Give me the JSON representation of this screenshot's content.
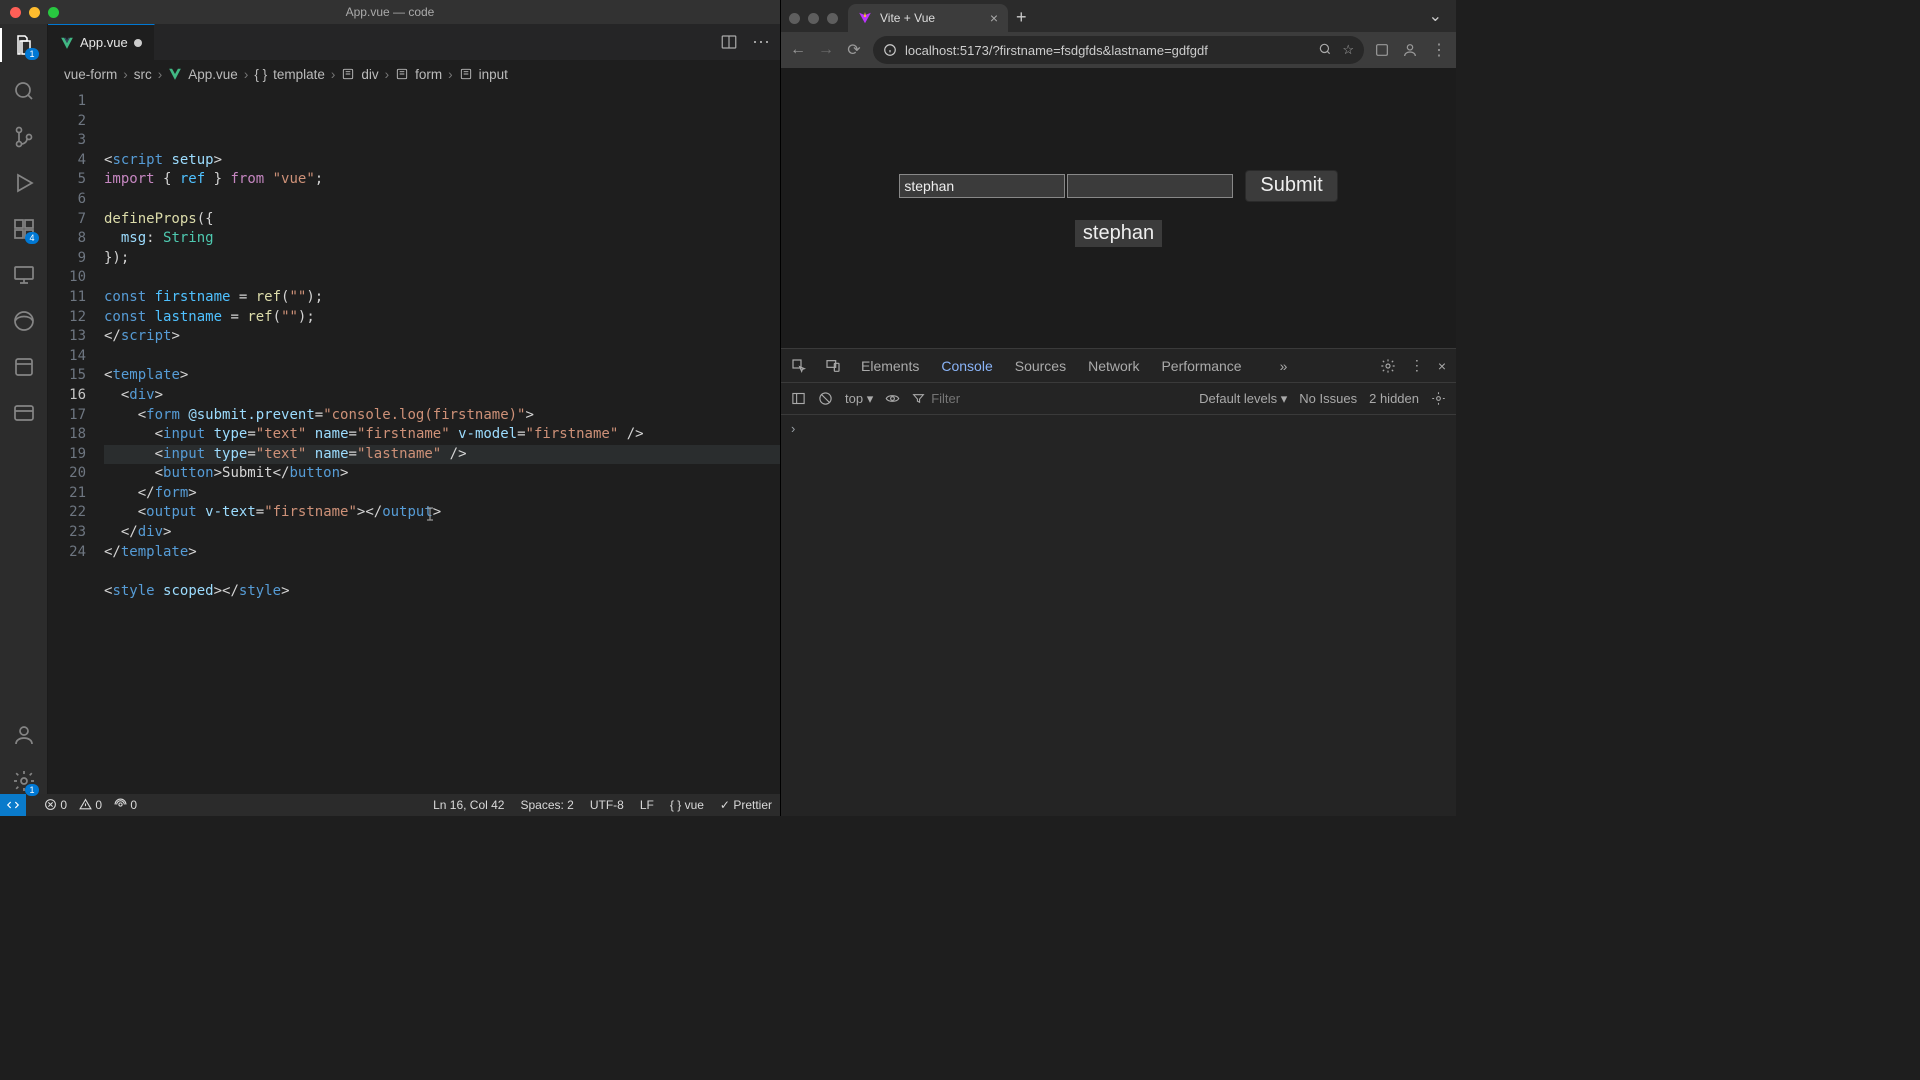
{
  "vscode": {
    "window_title": "App.vue — code",
    "tab": {
      "label": "App.vue"
    },
    "tab_actions": {
      "split": "▢",
      "more": "⋯"
    },
    "breadcrumbs": [
      "vue-form",
      "src",
      "App.vue",
      "template",
      "div",
      "form",
      "input"
    ],
    "gutter_highlight": 16,
    "code_lines": [
      {
        "n": 1,
        "html": "&lt;<span class='t-tag'>script</span> <span class='t-attr'>setup</span>&gt;"
      },
      {
        "n": 2,
        "html": "<span class='t-key'>import</span> { <span class='t-const'>ref</span> } <span class='t-key'>from</span> <span class='t-str'>\"vue\"</span>;"
      },
      {
        "n": 3,
        "html": ""
      },
      {
        "n": 4,
        "html": "<span class='t-fn'>defineProps</span>({"
      },
      {
        "n": 5,
        "html": "  <span class='t-attr'>msg</span>: <span class='t-type'>String</span>"
      },
      {
        "n": 6,
        "html": "});"
      },
      {
        "n": 7,
        "html": ""
      },
      {
        "n": 8,
        "html": "<span class='t-tag'>const</span> <span class='t-const'>firstname</span> = <span class='t-fn'>ref</span>(<span class='t-str'>\"\"</span>);"
      },
      {
        "n": 9,
        "html": "<span class='t-tag'>const</span> <span class='t-const'>lastname</span> = <span class='t-fn'>ref</span>(<span class='t-str'>\"\"</span>);"
      },
      {
        "n": 10,
        "html": "&lt;/<span class='t-tag'>script</span>&gt;"
      },
      {
        "n": 11,
        "html": ""
      },
      {
        "n": 12,
        "html": "&lt;<span class='t-tag'>template</span>&gt;"
      },
      {
        "n": 13,
        "html": "  &lt;<span class='t-tag'>div</span>&gt;"
      },
      {
        "n": 14,
        "html": "    &lt;<span class='t-tag'>form</span> <span class='t-attr'>@submit.prevent</span>=<span class='t-str'>\"console.log(firstname)\"</span>&gt;"
      },
      {
        "n": 15,
        "html": "      &lt;<span class='t-tag'>input</span> <span class='t-attr'>type</span>=<span class='t-str'>\"text\"</span> <span class='t-attr'>name</span>=<span class='t-str'>\"firstname\"</span> <span class='t-attr'>v-model</span>=<span class='t-str'>\"firstname\"</span> /&gt;"
      },
      {
        "n": 16,
        "html": "      &lt;<span class='t-tag'>input</span> <span class='t-attr'>type</span>=<span class='t-str'>\"text\"</span> <span class='t-attr'>name</span>=<span class='t-str'>\"lastname\"</span> /&gt;",
        "hl": true
      },
      {
        "n": 17,
        "html": "      &lt;<span class='t-tag'>button</span>&gt;Submit&lt;/<span class='t-tag'>button</span>&gt;"
      },
      {
        "n": 18,
        "html": "    &lt;/<span class='t-tag'>form</span>&gt;"
      },
      {
        "n": 19,
        "html": "    &lt;<span class='t-tag'>output</span> <span class='t-attr'>v-text</span>=<span class='t-str'>\"firstname\"</span>&gt;&lt;/<span class='t-tag'>output</span>&gt;"
      },
      {
        "n": 20,
        "html": "  &lt;/<span class='t-tag'>div</span>&gt;"
      },
      {
        "n": 21,
        "html": "&lt;/<span class='t-tag'>template</span>&gt;"
      },
      {
        "n": 22,
        "html": ""
      },
      {
        "n": 23,
        "html": "&lt;<span class='t-tag'>style</span> <span class='t-attr'>scoped</span>&gt;&lt;/<span class='t-tag'>style</span>&gt;"
      },
      {
        "n": 24,
        "html": ""
      }
    ],
    "activity_badges": {
      "explorer": "1",
      "extensions": "4",
      "settings": "1"
    },
    "status": {
      "errors": "0",
      "warnings": "0",
      "ports": "0",
      "cursor": "Ln 16, Col 42",
      "spaces": "Spaces: 2",
      "encoding": "UTF-8",
      "eol": "LF",
      "lang": "vue",
      "prettier": "Prettier"
    }
  },
  "browser": {
    "tab_title": "Vite + Vue",
    "url": "localhost:5173/?firstname=fsdgfds&lastname=gdfgdf",
    "page": {
      "firstname_value": "stephan",
      "lastname_value": "",
      "submit_label": "Submit",
      "output_text": "stephan"
    },
    "devtools": {
      "tabs": [
        "Elements",
        "Console",
        "Sources",
        "Network",
        "Performance"
      ],
      "active_tab": "Console",
      "context": "top",
      "filter_placeholder": "Filter",
      "levels": "Default levels",
      "issues": "No Issues",
      "hidden": "2 hidden"
    }
  }
}
